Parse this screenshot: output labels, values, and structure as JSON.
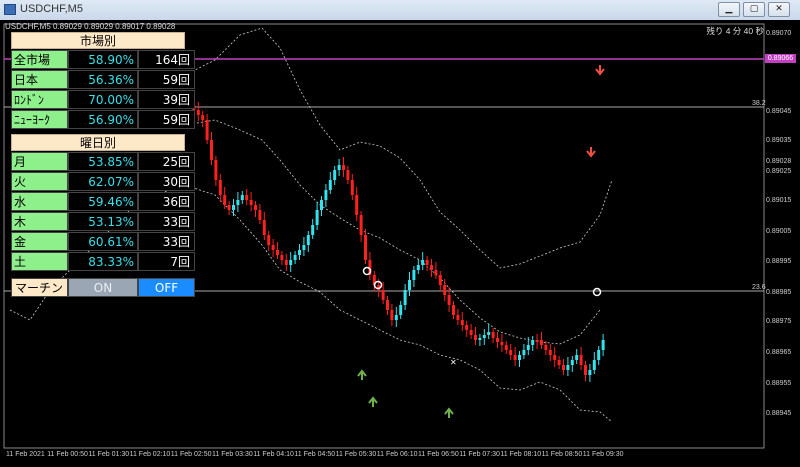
{
  "window": {
    "title": "USDCHF,M5"
  },
  "chart": {
    "info_line": "USDCHF,M5  0.89029 0.89029 0.89017 0.89028",
    "timer": "残り 4 分 40 秒",
    "price_labels": [
      {
        "text": "0.89070"
      },
      {
        "text": "0.89065"
      },
      {
        "text": "0.89045"
      },
      {
        "text": "0.89035"
      },
      {
        "text": "0.89028"
      },
      {
        "text": "0.89025"
      },
      {
        "text": "0.89015"
      },
      {
        "text": "0.89005"
      },
      {
        "text": "0.88995"
      },
      {
        "text": "0.88985"
      },
      {
        "text": "0.88975"
      },
      {
        "text": "0.88965"
      },
      {
        "text": "0.88955"
      },
      {
        "text": "0.88945"
      }
    ],
    "current_price_tag": "0.89066",
    "level_labels": [
      "38.2",
      "23.6"
    ],
    "time_labels": [
      "11 Feb 2021",
      "11 Feb 00:50",
      "11 Feb 01:30",
      "11 Feb 02:10",
      "11 Feb 02:50",
      "11 Feb 03:30",
      "11 Feb 04:10",
      "11 Feb 04:50",
      "11 Feb 05:30",
      "11 Feb 06:10",
      "11 Feb 06:50",
      "11 Feb 07:30",
      "11 Feb 08:10",
      "11 Feb 08:50",
      "11 Feb 09:30"
    ],
    "colors": {
      "bull": "#32e4ee",
      "bear": "#ff2020",
      "up_arrow": "#6fb24a",
      "down_arrow": "#f05040",
      "magenta": "#c040c0"
    }
  },
  "stats": {
    "market_header": "市場別",
    "market_rows": [
      {
        "name": "全市場",
        "pct": "58.90%",
        "count": "164回"
      },
      {
        "name": "日本",
        "pct": "56.36%",
        "count": "59回"
      },
      {
        "name": "ﾛﾝﾄﾞﾝ",
        "pct": "70.00%",
        "count": "39回"
      },
      {
        "name": "ﾆｭｰﾖｰｸ",
        "pct": "56.90%",
        "count": "59回"
      }
    ],
    "weekday_header": "曜日別",
    "weekday_rows": [
      {
        "name": "月",
        "pct": "53.85%",
        "count": "25回"
      },
      {
        "name": "火",
        "pct": "62.07%",
        "count": "30回"
      },
      {
        "name": "水",
        "pct": "59.46%",
        "count": "36回"
      },
      {
        "name": "木",
        "pct": "53.13%",
        "count": "33回"
      },
      {
        "name": "金",
        "pct": "60.61%",
        "count": "33回"
      },
      {
        "name": "土",
        "pct": "83.33%",
        "count": "7回"
      }
    ],
    "martin_label": "マーチン",
    "on_label": "ON",
    "off_label": "OFF"
  }
}
